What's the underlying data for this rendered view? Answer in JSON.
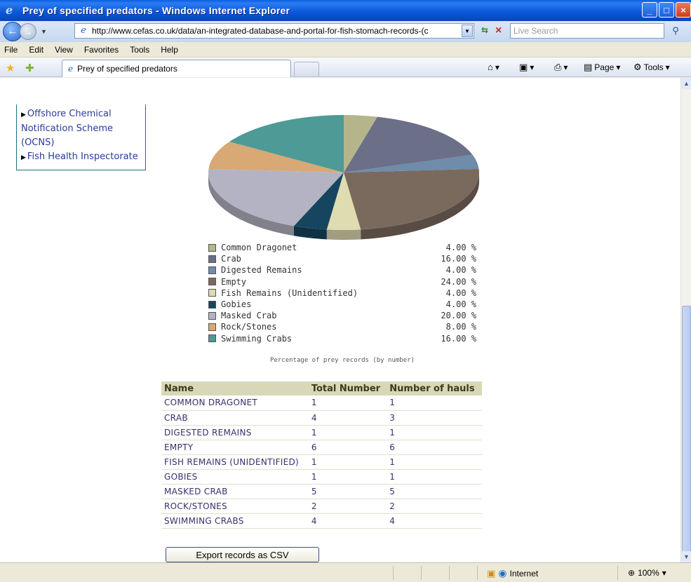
{
  "window": {
    "title": "Prey of specified predators - Windows Internet Explorer"
  },
  "address": {
    "url": "http://www.cefas.co.uk/data/an-integrated-database-and-portal-for-fish-stomach-records-(c",
    "search_placeholder": "Live Search"
  },
  "menu": [
    "File",
    "Edit",
    "View",
    "Favorites",
    "Tools",
    "Help"
  ],
  "tab": {
    "label": "Prey of specified predators"
  },
  "commands": {
    "page": "Page",
    "tools": "Tools"
  },
  "sidebar": {
    "items": [
      "Offshore Chemical Notification Scheme (OCNS)",
      "Fish Health Inspectorate"
    ]
  },
  "chart_data": {
    "type": "pie",
    "title": "",
    "caption": "Percentage of prey records (by number)",
    "categories": [
      "Common Dragonet",
      "Crab",
      "Digested Remains",
      "Empty",
      "Fish Remains (Unidentified)",
      "Gobies",
      "Masked Crab",
      "Rock/Stones",
      "Swimming Crabs"
    ],
    "values": [
      4.0,
      16.0,
      4.0,
      24.0,
      4.0,
      4.0,
      20.0,
      8.0,
      16.0
    ],
    "value_labels": [
      "4.00 %",
      "16.00 %",
      "4.00 %",
      "24.00 %",
      "4.00 %",
      "4.00 %",
      "20.00 %",
      "8.00 %",
      "16.00 %"
    ],
    "colors": [
      "#b5b58c",
      "#6b6f87",
      "#6f8cab",
      "#7a6a5e",
      "#dedcb0",
      "#16465f",
      "#b3b3c3",
      "#d8a875",
      "#4d9a96"
    ],
    "legend_position": "bottom"
  },
  "table": {
    "headers": [
      "Name",
      "Total Number",
      "Number of hauls"
    ],
    "rows": [
      [
        "COMMON DRAGONET",
        "1",
        "1"
      ],
      [
        "CRAB",
        "4",
        "3"
      ],
      [
        "DIGESTED REMAINS",
        "1",
        "1"
      ],
      [
        "EMPTY",
        "6",
        "6"
      ],
      [
        "FISH REMAINS (UNIDENTIFIED)",
        "1",
        "1"
      ],
      [
        "GOBIES",
        "1",
        "1"
      ],
      [
        "MASKED CRAB",
        "5",
        "5"
      ],
      [
        "ROCK/STONES",
        "2",
        "2"
      ],
      [
        "SWIMMING CRABS",
        "4",
        "4"
      ]
    ]
  },
  "export": {
    "label": "Export records as CSV"
  },
  "status": {
    "zone": "Internet",
    "zoom": "100%"
  }
}
